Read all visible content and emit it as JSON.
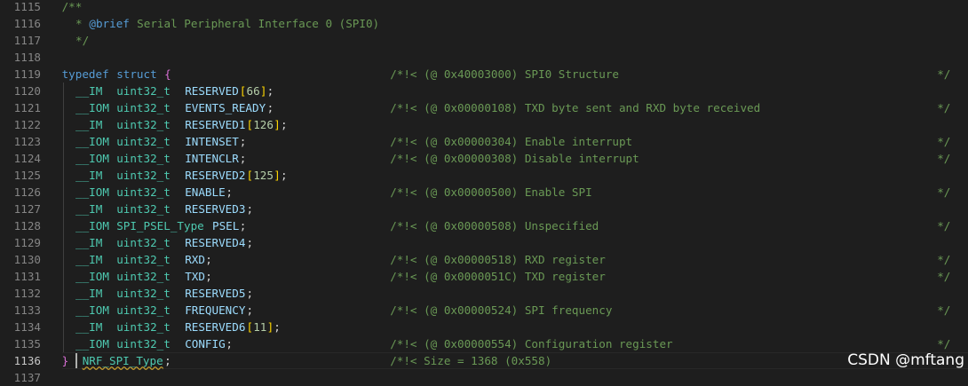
{
  "colors": {
    "background": "#1e1e1e",
    "line_number": "#858585",
    "line_number_active": "#c6c6c6",
    "comment": "#6a9955",
    "keyword": "#569cd6",
    "type": "#4ec9b0",
    "identifier": "#9cdcfe",
    "number": "#b5cea8",
    "brace": "#da70d6",
    "bracket": "#ffd700"
  },
  "editor": {
    "active_line": "1136",
    "lines": [
      {
        "num": "1115",
        "segs": [
          {
            "c": 8,
            "text": "/**",
            "t": "comment"
          }
        ]
      },
      {
        "num": "1116",
        "segs": [
          {
            "c": 10,
            "text": "* ",
            "t": "comment"
          },
          {
            "c": 12,
            "text": "@brief",
            "t": "doctag"
          },
          {
            "c": 18,
            "text": " Serial Peripheral Interface 0 (SPI0)",
            "t": "comment"
          }
        ]
      },
      {
        "num": "1117",
        "segs": [
          {
            "c": 10,
            "text": "*/",
            "t": "comment"
          }
        ]
      },
      {
        "num": "1118",
        "segs": []
      },
      {
        "num": "1119",
        "segs": [
          {
            "c": 8,
            "text": "typedef",
            "t": "keyword"
          },
          {
            "c": 16,
            "text": "struct",
            "t": "keyword"
          },
          {
            "c": 23,
            "text": "{",
            "t": "brace"
          },
          {
            "c": 56,
            "text": "/*!< (@ 0x40003000) SPI0 Structure",
            "t": "comment"
          },
          {
            "c": 136,
            "text": "*/",
            "t": "comment"
          }
        ]
      },
      {
        "num": "1120",
        "segs": [
          {
            "c": 10,
            "text": "__IM",
            "t": "type"
          },
          {
            "c": 16,
            "text": "uint32_t",
            "t": "type"
          },
          {
            "c": 26,
            "text": "RESERVED",
            "t": "ident"
          },
          {
            "c": 34,
            "text": "[",
            "t": "bracket"
          },
          {
            "c": 35,
            "text": "66",
            "t": "number"
          },
          {
            "c": 37,
            "text": "]",
            "t": "bracket"
          },
          {
            "c": 38,
            "text": ";",
            "t": "punct"
          }
        ]
      },
      {
        "num": "1121",
        "segs": [
          {
            "c": 10,
            "text": "__IOM",
            "t": "type"
          },
          {
            "c": 16,
            "text": "uint32_t",
            "t": "type"
          },
          {
            "c": 26,
            "text": "EVENTS_READY",
            "t": "ident"
          },
          {
            "c": 38,
            "text": ";",
            "t": "punct"
          },
          {
            "c": 56,
            "text": "/*!< (@ 0x00000108) TXD byte sent and RXD byte received",
            "t": "comment"
          },
          {
            "c": 136,
            "text": "*/",
            "t": "comment"
          }
        ]
      },
      {
        "num": "1122",
        "segs": [
          {
            "c": 10,
            "text": "__IM",
            "t": "type"
          },
          {
            "c": 16,
            "text": "uint32_t",
            "t": "type"
          },
          {
            "c": 26,
            "text": "RESERVED1",
            "t": "ident"
          },
          {
            "c": 35,
            "text": "[",
            "t": "bracket"
          },
          {
            "c": 36,
            "text": "126",
            "t": "number"
          },
          {
            "c": 39,
            "text": "]",
            "t": "bracket"
          },
          {
            "c": 40,
            "text": ";",
            "t": "punct"
          }
        ]
      },
      {
        "num": "1123",
        "segs": [
          {
            "c": 10,
            "text": "__IOM",
            "t": "type"
          },
          {
            "c": 16,
            "text": "uint32_t",
            "t": "type"
          },
          {
            "c": 26,
            "text": "INTENSET",
            "t": "ident"
          },
          {
            "c": 34,
            "text": ";",
            "t": "punct"
          },
          {
            "c": 56,
            "text": "/*!< (@ 0x00000304) Enable interrupt",
            "t": "comment"
          },
          {
            "c": 136,
            "text": "*/",
            "t": "comment"
          }
        ]
      },
      {
        "num": "1124",
        "segs": [
          {
            "c": 10,
            "text": "__IOM",
            "t": "type"
          },
          {
            "c": 16,
            "text": "uint32_t",
            "t": "type"
          },
          {
            "c": 26,
            "text": "INTENCLR",
            "t": "ident"
          },
          {
            "c": 34,
            "text": ";",
            "t": "punct"
          },
          {
            "c": 56,
            "text": "/*!< (@ 0x00000308) Disable interrupt",
            "t": "comment"
          },
          {
            "c": 136,
            "text": "*/",
            "t": "comment"
          }
        ]
      },
      {
        "num": "1125",
        "segs": [
          {
            "c": 10,
            "text": "__IM",
            "t": "type"
          },
          {
            "c": 16,
            "text": "uint32_t",
            "t": "type"
          },
          {
            "c": 26,
            "text": "RESERVED2",
            "t": "ident"
          },
          {
            "c": 35,
            "text": "[",
            "t": "bracket"
          },
          {
            "c": 36,
            "text": "125",
            "t": "number"
          },
          {
            "c": 39,
            "text": "]",
            "t": "bracket"
          },
          {
            "c": 40,
            "text": ";",
            "t": "punct"
          }
        ]
      },
      {
        "num": "1126",
        "segs": [
          {
            "c": 10,
            "text": "__IOM",
            "t": "type"
          },
          {
            "c": 16,
            "text": "uint32_t",
            "t": "type"
          },
          {
            "c": 26,
            "text": "ENABLE",
            "t": "ident"
          },
          {
            "c": 32,
            "text": ";",
            "t": "punct"
          },
          {
            "c": 56,
            "text": "/*!< (@ 0x00000500) Enable SPI",
            "t": "comment"
          },
          {
            "c": 136,
            "text": "*/",
            "t": "comment"
          }
        ]
      },
      {
        "num": "1127",
        "segs": [
          {
            "c": 10,
            "text": "__IM",
            "t": "type"
          },
          {
            "c": 16,
            "text": "uint32_t",
            "t": "type"
          },
          {
            "c": 26,
            "text": "RESERVED3",
            "t": "ident"
          },
          {
            "c": 35,
            "text": ";",
            "t": "punct"
          }
        ]
      },
      {
        "num": "1128",
        "segs": [
          {
            "c": 10,
            "text": "__IOM",
            "t": "type"
          },
          {
            "c": 16,
            "text": "SPI_PSEL_Type",
            "t": "type"
          },
          {
            "c": 30,
            "text": "PSEL",
            "t": "ident"
          },
          {
            "c": 34,
            "text": ";",
            "t": "punct"
          },
          {
            "c": 56,
            "text": "/*!< (@ 0x00000508) Unspecified",
            "t": "comment"
          },
          {
            "c": 136,
            "text": "*/",
            "t": "comment"
          }
        ]
      },
      {
        "num": "1129",
        "segs": [
          {
            "c": 10,
            "text": "__IM",
            "t": "type"
          },
          {
            "c": 16,
            "text": "uint32_t",
            "t": "type"
          },
          {
            "c": 26,
            "text": "RESERVED4",
            "t": "ident"
          },
          {
            "c": 35,
            "text": ";",
            "t": "punct"
          }
        ]
      },
      {
        "num": "1130",
        "segs": [
          {
            "c": 10,
            "text": "__IM",
            "t": "type"
          },
          {
            "c": 16,
            "text": "uint32_t",
            "t": "type"
          },
          {
            "c": 26,
            "text": "RXD",
            "t": "ident"
          },
          {
            "c": 29,
            "text": ";",
            "t": "punct"
          },
          {
            "c": 56,
            "text": "/*!< (@ 0x00000518) RXD register",
            "t": "comment"
          },
          {
            "c": 136,
            "text": "*/",
            "t": "comment"
          }
        ]
      },
      {
        "num": "1131",
        "segs": [
          {
            "c": 10,
            "text": "__IOM",
            "t": "type"
          },
          {
            "c": 16,
            "text": "uint32_t",
            "t": "type"
          },
          {
            "c": 26,
            "text": "TXD",
            "t": "ident"
          },
          {
            "c": 29,
            "text": ";",
            "t": "punct"
          },
          {
            "c": 56,
            "text": "/*!< (@ 0x0000051C) TXD register",
            "t": "comment"
          },
          {
            "c": 136,
            "text": "*/",
            "t": "comment"
          }
        ]
      },
      {
        "num": "1132",
        "segs": [
          {
            "c": 10,
            "text": "__IM",
            "t": "type"
          },
          {
            "c": 16,
            "text": "uint32_t",
            "t": "type"
          },
          {
            "c": 26,
            "text": "RESERVED5",
            "t": "ident"
          },
          {
            "c": 35,
            "text": ";",
            "t": "punct"
          }
        ]
      },
      {
        "num": "1133",
        "segs": [
          {
            "c": 10,
            "text": "__IOM",
            "t": "type"
          },
          {
            "c": 16,
            "text": "uint32_t",
            "t": "type"
          },
          {
            "c": 26,
            "text": "FREQUENCY",
            "t": "ident"
          },
          {
            "c": 35,
            "text": ";",
            "t": "punct"
          },
          {
            "c": 56,
            "text": "/*!< (@ 0x00000524) SPI frequency",
            "t": "comment"
          },
          {
            "c": 136,
            "text": "*/",
            "t": "comment"
          }
        ]
      },
      {
        "num": "1134",
        "segs": [
          {
            "c": 10,
            "text": "__IM",
            "t": "type"
          },
          {
            "c": 16,
            "text": "uint32_t",
            "t": "type"
          },
          {
            "c": 26,
            "text": "RESERVED6",
            "t": "ident"
          },
          {
            "c": 35,
            "text": "[",
            "t": "bracket"
          },
          {
            "c": 36,
            "text": "11",
            "t": "number"
          },
          {
            "c": 38,
            "text": "]",
            "t": "bracket"
          },
          {
            "c": 39,
            "text": ";",
            "t": "punct"
          }
        ]
      },
      {
        "num": "1135",
        "segs": [
          {
            "c": 10,
            "text": "__IOM",
            "t": "type"
          },
          {
            "c": 16,
            "text": "uint32_t",
            "t": "type"
          },
          {
            "c": 26,
            "text": "CONFIG",
            "t": "ident"
          },
          {
            "c": 32,
            "text": ";",
            "t": "punct"
          },
          {
            "c": 56,
            "text": "/*!< (@ 0x00000554) Configuration register",
            "t": "comment"
          },
          {
            "c": 136,
            "text": "*/",
            "t": "comment"
          }
        ]
      },
      {
        "num": "1136",
        "segs": [
          {
            "c": 8,
            "text": "}",
            "t": "brace"
          },
          {
            "c": 11,
            "text": "NRF_SPI_Type",
            "t": "type"
          },
          {
            "c": 23,
            "text": ";",
            "t": "punct"
          },
          {
            "c": 56,
            "text": "/*!< Size = 1368 (0x558)",
            "t": "comment"
          }
        ]
      },
      {
        "num": "1137",
        "segs": []
      }
    ]
  },
  "watermark": "CSDN @mftang"
}
